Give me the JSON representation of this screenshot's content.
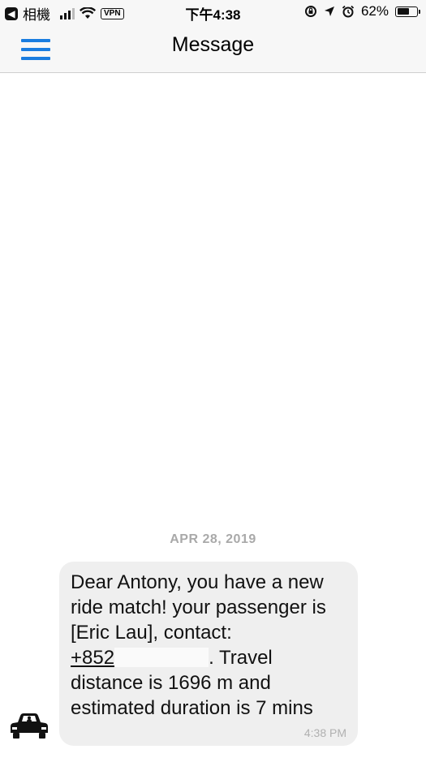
{
  "status_bar": {
    "back_app": "相機",
    "vpn": "VPN",
    "time": "下午4:38",
    "battery": "62%",
    "battery_level": 0.62
  },
  "nav": {
    "title": "Message"
  },
  "chat": {
    "date": "APR 28, 2019",
    "message": {
      "line1": "Dear Antony, you have a new",
      "line2": "ride match! your passenger is",
      "line3": "[Eric Lau], contact:",
      "phone": "+852",
      "line4_tail": ". Travel",
      "line5": "distance is 1696 m and",
      "line6": "estimated duration is 7 mins",
      "time": "4:38 PM"
    }
  }
}
